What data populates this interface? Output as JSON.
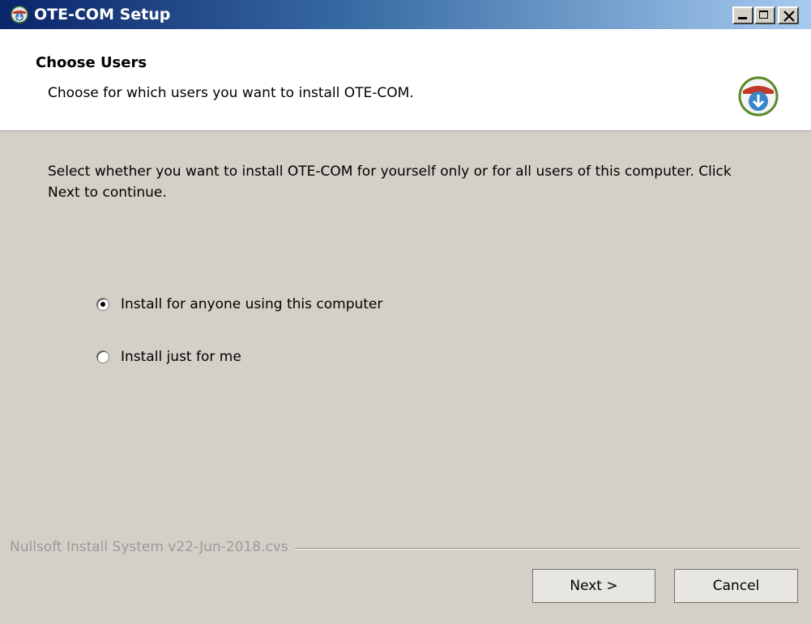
{
  "window": {
    "title": "OTE-COM Setup"
  },
  "header": {
    "title": "Choose Users",
    "subtitle": "Choose for which users you want to install OTE-COM."
  },
  "body": {
    "intro": "Select whether you want to install OTE-COM for yourself only or for all users of this computer. Click Next to continue.",
    "options": [
      {
        "label": "Install for anyone using this computer",
        "selected": true
      },
      {
        "label": "Install just for me",
        "selected": false
      }
    ]
  },
  "footer": {
    "branding": "Nullsoft Install System v22-Jun-2018.cvs",
    "next_label": "Next >",
    "cancel_label": "Cancel"
  },
  "icons": {
    "title_icon": "installer-globe-icon",
    "header_icon": "installer-download-icon"
  }
}
